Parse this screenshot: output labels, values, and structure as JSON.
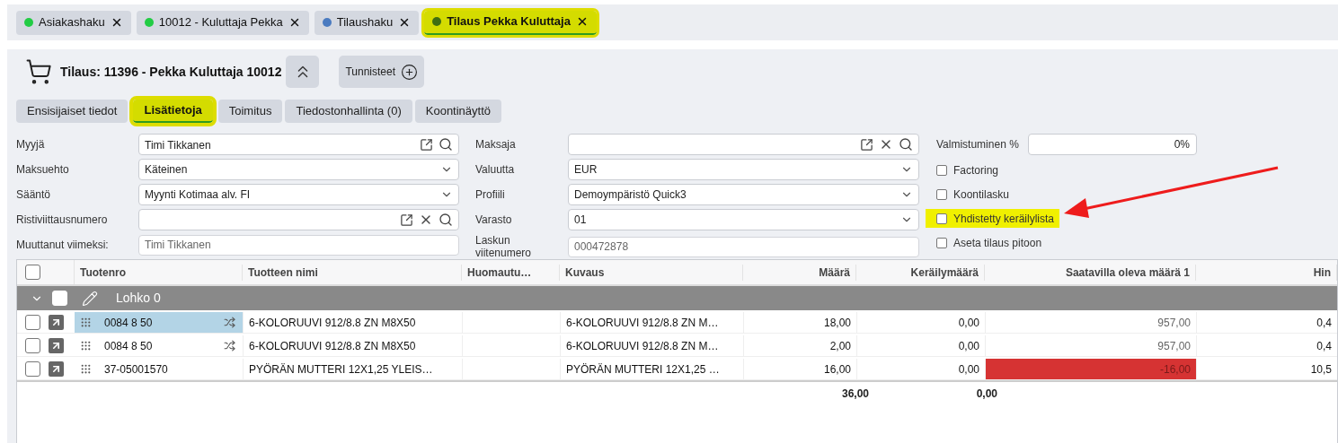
{
  "open_tabs": [
    {
      "label": "Asiakashaku",
      "color": "#22cc44",
      "selected": false,
      "highlighted": false
    },
    {
      "label": "10012 - Kuluttaja Pekka",
      "color": "#22cc44",
      "selected": false,
      "highlighted": false
    },
    {
      "label": "Tilaushaku",
      "color": "#4a7bc0",
      "selected": false,
      "highlighted": false
    },
    {
      "label": "Tilaus Pekka Kuluttaja",
      "color": "#3f6e12",
      "selected": true,
      "highlighted": true
    }
  ],
  "header": {
    "title": "Tilaus: 11396 - Pekka Kuluttaja 10012",
    "tags_button": "Tunnisteet"
  },
  "tabs": [
    {
      "label": "Ensisijaiset tiedot",
      "selected": false,
      "highlighted": false
    },
    {
      "label": "Lisätietoja",
      "selected": true,
      "highlighted": true
    },
    {
      "label": "Toimitus",
      "selected": false,
      "highlighted": false
    },
    {
      "label": "Tiedostonhallinta (0)",
      "selected": false,
      "highlighted": false
    },
    {
      "label": "Koontinäyttö",
      "selected": false,
      "highlighted": false
    }
  ],
  "form_left": [
    {
      "label": "Myyjä",
      "kind": "lookup",
      "value": "Timi Tikkanen",
      "clearable": false
    },
    {
      "label": "Maksuehto",
      "kind": "select",
      "value": "Käteinen"
    },
    {
      "label": "Sääntö",
      "kind": "select",
      "value": "Myynti Kotimaa alv. FI"
    },
    {
      "label": "Ristiviittausnumero",
      "kind": "lookup",
      "clearable": true
    },
    {
      "label": "Muuttanut viimeksi:",
      "kind": "readonly",
      "value": "Timi Tikkanen"
    }
  ],
  "form_middle": [
    {
      "label": "Maksaja",
      "kind": "lookup",
      "clearable": true
    },
    {
      "label": "Valuutta",
      "kind": "select",
      "value": "EUR"
    },
    {
      "label": "Profiili",
      "kind": "select",
      "value": "Demoympäristö Quick3"
    },
    {
      "label": "Varasto",
      "kind": "select",
      "value": "01"
    },
    {
      "label": "Laskun viitenumero",
      "kind": "readonly",
      "value": "000472878"
    }
  ],
  "completion": {
    "label": "Valmistuminen %",
    "value": "0%"
  },
  "checkboxes": [
    {
      "label": "Factoring",
      "checked": false,
      "highlighted": false
    },
    {
      "label": "Koontilasku",
      "checked": false,
      "highlighted": false
    },
    {
      "label": "Yhdistetty keräilylista",
      "checked": false,
      "highlighted": true
    },
    {
      "label": "Aseta tilaus pitoon",
      "checked": false,
      "highlighted": false
    }
  ],
  "table": {
    "columns": [
      "Tuotenro",
      "Tuotteen nimi",
      "Huomautu…",
      "Kuvaus",
      "Määrä",
      "Keräilymäärä",
      "Saatavilla oleva määrä 1",
      "Hin"
    ],
    "all_checked": false,
    "group": {
      "label": "Lohko 0",
      "expanded": true,
      "checked": false
    },
    "rows": [
      {
        "checked": false,
        "selected": true,
        "shuffle": true,
        "cells": [
          "0084 8 50",
          "6-KOLORUUVI 912/8.8 ZN M8X50",
          "",
          "6-KOLORUUVI 912/8.8 ZN M…",
          "18,00",
          "0,00",
          "957,00",
          "0,4"
        ],
        "negative": false
      },
      {
        "checked": false,
        "selected": false,
        "shuffle": true,
        "cells": [
          "0084 8 50",
          "6-KOLORUUVI 912/8.8 ZN M8X50",
          "",
          "6-KOLORUUVI 912/8.8 ZN M…",
          "2,00",
          "0,00",
          "957,00",
          "0,4"
        ],
        "negative": false
      },
      {
        "checked": false,
        "selected": false,
        "shuffle": false,
        "cells": [
          "37-05001570",
          "PYÖRÄN MUTTERI 12X1,25 YLEIS…",
          "",
          "PYÖRÄN MUTTERI 12X1,25 …",
          "16,00",
          "0,00",
          "-16,00",
          "10,5"
        ],
        "negative": true
      }
    ],
    "totals": [
      "36,00",
      "0,00"
    ]
  }
}
